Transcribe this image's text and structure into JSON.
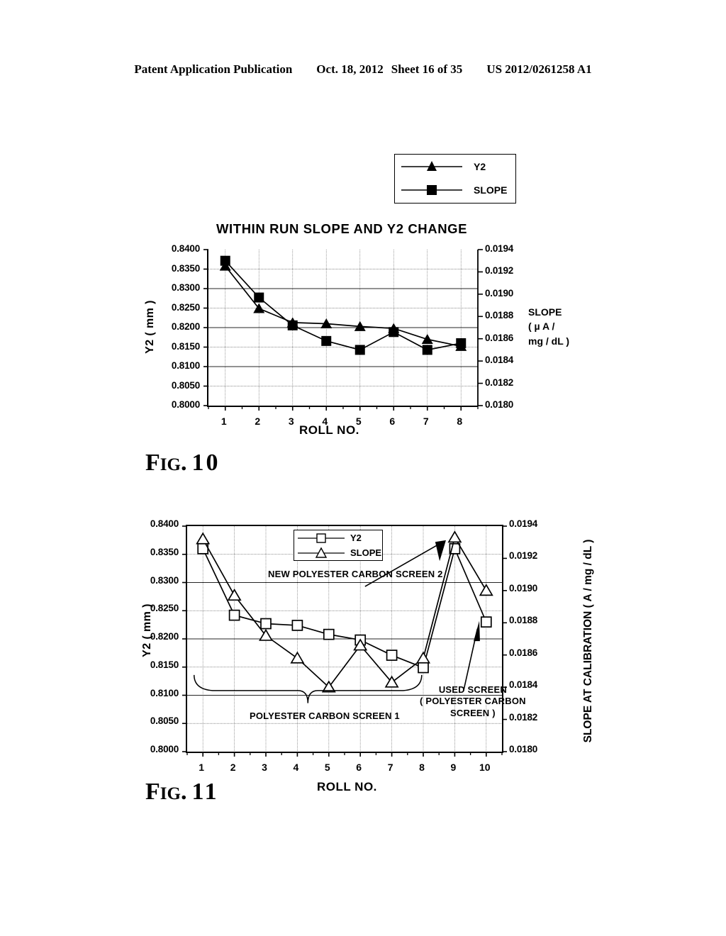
{
  "header": {
    "publication": "Patent Application Publication",
    "date": "Oct. 18, 2012",
    "sheet": "Sheet 16 of 35",
    "docnum": "US 2012/0261258 A1"
  },
  "figure10": {
    "caption_fig": "F",
    "caption_ig": "IG",
    "caption_dot": ".",
    "caption_number": "10",
    "title": "WITHIN RUN SLOPE AND Y2 CHANGE",
    "y_axis_label": "Y2 ( mm )",
    "x_axis_label": "ROLL NO.",
    "right_axis_label_line1": "SLOPE",
    "right_axis_label_line2": "( µ A /",
    "right_axis_label_line3": "mg / dL )",
    "legend": [
      {
        "label": "Y2",
        "marker": "filled-triangle-marker"
      },
      {
        "label": "SLOPE",
        "marker": "filled-square-marker"
      }
    ],
    "chart_data": {
      "type": "line",
      "title": "WITHIN RUN SLOPE AND Y2 CHANGE",
      "xlabel": "ROLL NO.",
      "ylabel": "Y2 ( mm )",
      "y2label": "SLOPE ( µ A / mg / dL )",
      "x": [
        1,
        2,
        3,
        4,
        5,
        6,
        7,
        8
      ],
      "xticklabels": [
        "1",
        "2",
        "3",
        "4",
        "5",
        "6",
        "7",
        "8"
      ],
      "xlim": [
        0.5,
        8.5
      ],
      "ylim": [
        0.8,
        0.84
      ],
      "yticks": [
        0.8,
        0.805,
        0.81,
        0.815,
        0.82,
        0.825,
        0.83,
        0.835,
        0.84
      ],
      "yticklabels": [
        "0.8000",
        "0.8050",
        "0.8100",
        "0.8150",
        "0.8200",
        "0.8250",
        "0.8300",
        "0.8350",
        "0.8400"
      ],
      "y2lim": [
        0.018,
        0.0194
      ],
      "y2ticks": [
        0.018,
        0.0182,
        0.0184,
        0.0186,
        0.0188,
        0.019,
        0.0192,
        0.0194
      ],
      "y2ticklabels": [
        "0.0180",
        "0.0182",
        "0.0184",
        "0.0186",
        "0.0188",
        "0.0190",
        "0.0192",
        "0.0194"
      ],
      "grid": true,
      "legend_position": "above-right",
      "series": [
        {
          "name": "Y2",
          "axis": "left",
          "marker": "filled-triangle",
          "values": [
            0.8358,
            0.8249,
            0.8213,
            0.821,
            0.8203,
            0.8198,
            0.817,
            0.8152
          ]
        },
        {
          "name": "SLOPE",
          "axis": "right",
          "marker": "filled-square",
          "values": [
            0.0193,
            0.01897,
            0.01872,
            0.01858,
            0.0185,
            0.01866,
            0.0185,
            0.01856
          ]
        }
      ]
    }
  },
  "figure11": {
    "caption_fig": "F",
    "caption_ig": "IG",
    "caption_dot": ".",
    "caption_number": "11",
    "y_axis_label": "Y2 ( mm )",
    "x_axis_label": "ROLL NO.",
    "right_axis_label": "SLOPE AT CALIBRATION ( A / mg / dL )",
    "legend": [
      {
        "label": "Y2",
        "marker": "open-square-marker"
      },
      {
        "label": "SLOPE",
        "marker": "open-triangle-marker"
      }
    ],
    "annotations": [
      {
        "name": "new-screen-annotation",
        "text": "NEW POLYESTER CARBON SCREEN 2"
      },
      {
        "name": "screen1-annotation",
        "text": "POLYESTER CARBON SCREEN 1"
      },
      {
        "name": "used-screen-annotation-line1",
        "text": "USED SCREEN"
      },
      {
        "name": "used-screen-annotation-line2",
        "text": "( POLYESTER CARBON"
      },
      {
        "name": "used-screen-annotation-line3",
        "text": "SCREEN )"
      }
    ],
    "chart_data": {
      "type": "line",
      "title": "",
      "xlabel": "ROLL NO.",
      "ylabel": "Y2 ( mm )",
      "y2label": "SLOPE AT CALIBRATION ( A / mg / dL )",
      "x": [
        1,
        2,
        3,
        4,
        5,
        6,
        7,
        8,
        9,
        10
      ],
      "xticklabels": [
        "1",
        "2",
        "3",
        "4",
        "5",
        "6",
        "7",
        "8",
        "9",
        "10"
      ],
      "xlim": [
        0.5,
        10.5
      ],
      "ylim": [
        0.8,
        0.84
      ],
      "yticks": [
        0.8,
        0.805,
        0.81,
        0.815,
        0.82,
        0.825,
        0.83,
        0.835,
        0.84
      ],
      "yticklabels": [
        "0.8000",
        "0.8050",
        "0.8100",
        "0.8150",
        "0.8200",
        "0.8250",
        "0.8300",
        "0.8350",
        "0.8400"
      ],
      "y2lim": [
        0.018,
        0.0194
      ],
      "y2ticks": [
        0.018,
        0.0182,
        0.0184,
        0.0186,
        0.0188,
        0.019,
        0.0192,
        0.0194
      ],
      "y2ticklabels": [
        "0.0180",
        "0.0182",
        "0.0184",
        "0.0186",
        "0.0188",
        "0.0190",
        "0.0192",
        "0.0194"
      ],
      "grid": true,
      "legend_position": "inside-top-center",
      "series": [
        {
          "name": "Y2",
          "axis": "left",
          "marker": "open-square",
          "values": [
            0.836,
            0.8242,
            0.8227,
            0.8224,
            0.8208,
            0.8198,
            0.8171,
            0.8149,
            0.836,
            0.823
          ]
        },
        {
          "name": "SLOPE",
          "axis": "right",
          "marker": "open-triangle",
          "values": [
            0.01932,
            0.01897,
            0.01872,
            0.01858,
            0.0184,
            0.01866,
            0.01843,
            0.01858,
            0.01933,
            0.019
          ]
        }
      ]
    }
  }
}
